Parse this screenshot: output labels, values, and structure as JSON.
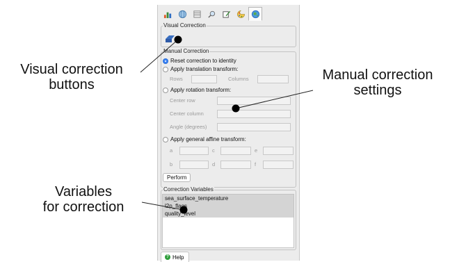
{
  "toolbar": {
    "icons": [
      "chart-icon",
      "globe-sphere-icon",
      "layers-icon",
      "magnifier-icon",
      "edit-icon",
      "palette-icon",
      "earth-correction-icon"
    ]
  },
  "visual_correction": {
    "title": "Visual Correction"
  },
  "manual_correction": {
    "title": "Manual Correction",
    "options": {
      "reset": "Reset correction to identity",
      "translation": "Apply translation transform:",
      "rotation": "Apply rotation transform:",
      "affine": "Apply general affine transform:"
    },
    "selected": "reset",
    "translation_fields": {
      "rows_label": "Rows",
      "columns_label": "Columns"
    },
    "rotation_fields": {
      "center_row_label": "Center row",
      "center_column_label": "Center column",
      "angle_label": "Angle (degrees)"
    },
    "affine_fields": {
      "a": "a",
      "b": "b",
      "c": "c",
      "d": "d",
      "e": "e",
      "f": "f"
    },
    "perform_label": "Perform"
  },
  "correction_variables": {
    "title": "Correction Variables",
    "items": [
      "sea_surface_temperature",
      "l2p_flags",
      "quality_level"
    ]
  },
  "help_label": "Help",
  "callouts": {
    "visual_buttons": "Visual correction\nbuttons",
    "manual_settings": "Manual correction\nsettings",
    "variables": "Variables\nfor correction"
  },
  "colors": {
    "panel_bg": "#ececec",
    "selected_radio": "#3b82f6",
    "help_icon": "#2e9e3b"
  }
}
